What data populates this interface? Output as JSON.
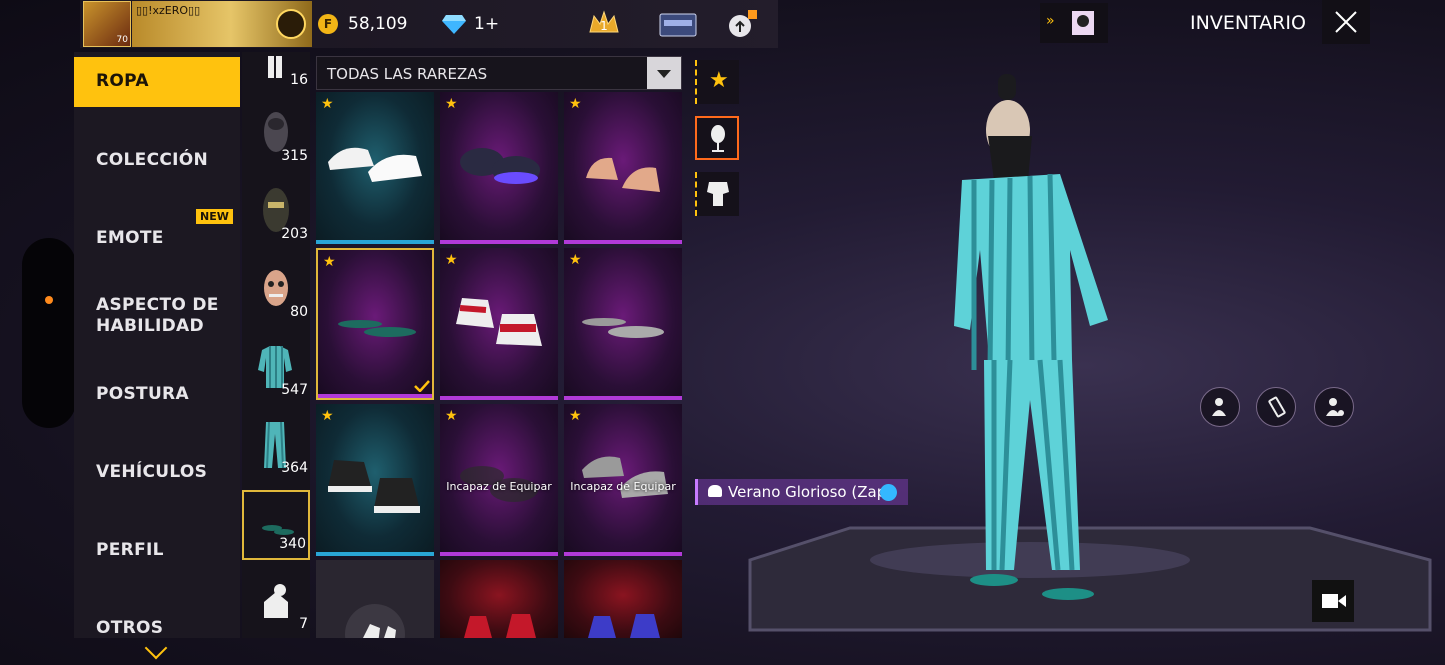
{
  "header": {
    "player_name": "▯▯!xzERO▯▯",
    "player_level": "70",
    "gold": "58,109",
    "diamonds": "1+",
    "rank_number": "1",
    "inventory_title": "INVENTARIO"
  },
  "nav": {
    "items": [
      {
        "label": "ROPA"
      },
      {
        "label": "COLECCIÓN"
      },
      {
        "label": "EMOTE"
      },
      {
        "label": "ASPECTO DE\nHABILIDAD"
      },
      {
        "label": "POSTURA"
      },
      {
        "label": "VEHÍCULOS"
      },
      {
        "label": "PERFIL"
      },
      {
        "label": "OTROS"
      }
    ],
    "new_badge": "NEW"
  },
  "categories": [
    {
      "icon": "pants-bottom-icon",
      "count": "16"
    },
    {
      "icon": "mask-icon",
      "count": "315"
    },
    {
      "icon": "helmet-mask-icon",
      "count": "203"
    },
    {
      "icon": "face-paint-icon",
      "count": "80"
    },
    {
      "icon": "shirt-icon",
      "count": "547"
    },
    {
      "icon": "pants-icon",
      "count": "364"
    },
    {
      "icon": "shoes-icon",
      "count": "340"
    },
    {
      "icon": "accessory-icon",
      "count": "7"
    }
  ],
  "filter": {
    "rarity_label": "TODAS LAS RAREZAS"
  },
  "grid": {
    "tiles": [
      {
        "item": "white-sneakers",
        "rarity": "blue",
        "note": ""
      },
      {
        "item": "purple-slippers",
        "rarity": "purple",
        "note": ""
      },
      {
        "item": "bare-feet",
        "rarity": "purple",
        "note": ""
      },
      {
        "item": "green-flip-flops",
        "rarity": "purple",
        "note": "",
        "selected": true
      },
      {
        "item": "red-high-tops",
        "rarity": "purple",
        "note": ""
      },
      {
        "item": "gray-flip-flops",
        "rarity": "purple",
        "note": ""
      },
      {
        "item": "black-converse",
        "rarity": "blue",
        "note": ""
      },
      {
        "item": "dark-boots",
        "rarity": "purple",
        "note": "Incapaz de Equipar"
      },
      {
        "item": "gray-sneakers",
        "rarity": "purple",
        "note": "Incapaz de Equipar"
      },
      {
        "item": "none-slot",
        "rarity": "gray",
        "note": ""
      },
      {
        "item": "red-shoes",
        "rarity": "red",
        "note": ""
      },
      {
        "item": "blue-shoes",
        "rarity": "red",
        "note": ""
      }
    ]
  },
  "equipped_tag": {
    "label": "Verano Glorioso (Zap"
  },
  "colors": {
    "accent": "#ffc20e",
    "blue_rarity": "#29a6d6",
    "purple_rarity": "#b13ad8",
    "red_rarity": "#c4182a"
  }
}
